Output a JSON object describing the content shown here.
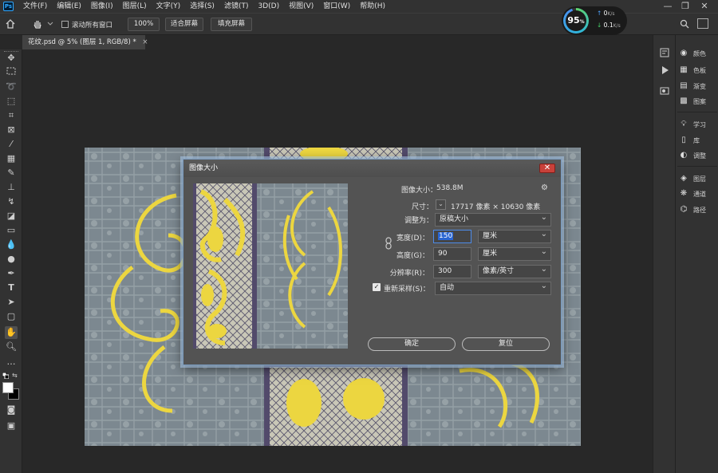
{
  "app": {
    "logo_text": "Ps"
  },
  "menu": {
    "items": [
      "文件(F)",
      "编辑(E)",
      "图像(I)",
      "图层(L)",
      "文字(Y)",
      "选择(S)",
      "滤镜(T)",
      "3D(D)",
      "视图(V)",
      "窗口(W)",
      "帮助(H)"
    ]
  },
  "window_controls": {
    "minimize": "—",
    "restore": "❐",
    "close": "✕"
  },
  "options_bar": {
    "scroll_all_label": "滚动所有窗口",
    "zoom_value": "100%",
    "fit_screen_label": "适合屏幕",
    "fill_screen_label": "填充屏幕"
  },
  "performance": {
    "percent": "95",
    "percent_unit": "%",
    "upload": "0",
    "download": "0.1",
    "unit": "K/s"
  },
  "document_tab": {
    "title": "花纹.psd @ 5% (图层 1, RGB/8) *"
  },
  "tools": [
    "move-icon",
    "marquee-icon",
    "lasso-icon",
    "object-select-icon",
    "crop-icon",
    "eyedropper-icon",
    "frame-icon",
    "healing-icon",
    "brush-icon",
    "stamp-icon",
    "history-brush-icon",
    "eraser-icon",
    "gradient-icon",
    "blur-icon",
    "dodge-icon",
    "pen-icon",
    "type-icon",
    "path-select-icon",
    "rectangle-icon",
    "hand-icon",
    "zoom-icon",
    "more-icon"
  ],
  "panels": {
    "items": [
      {
        "label": "颜色",
        "icon": "color-icon"
      },
      {
        "label": "色板",
        "icon": "swatches-icon"
      },
      {
        "label": "渐变",
        "icon": "gradient-panel-icon"
      },
      {
        "label": "图案",
        "icon": "pattern-icon"
      },
      {
        "label": "学习",
        "icon": "learn-icon"
      },
      {
        "label": "库",
        "icon": "library-icon"
      },
      {
        "label": "调整",
        "icon": "adjust-icon"
      },
      {
        "label": "图层",
        "icon": "layers-icon"
      },
      {
        "label": "通道",
        "icon": "channels-icon"
      },
      {
        "label": "路径",
        "icon": "paths-icon"
      }
    ]
  },
  "dialog": {
    "title": "图像大小",
    "image_size_label": "图像大小：",
    "image_size_value": "538.8M",
    "dimensions_label": "尺寸：",
    "dimensions_value": "17717 像素 × 10630 像素",
    "fit_to_label": "调整为：",
    "fit_to_value": "原稿大小",
    "width_label": "宽度(D)：",
    "width_value": "150",
    "width_unit": "厘米",
    "height_label": "高度(G)：",
    "height_value": "90",
    "height_unit": "厘米",
    "resolution_label": "分辨率(R)：",
    "resolution_value": "300",
    "resolution_unit": "像素/英寸",
    "resample_label": "重新采样(S)：",
    "resample_value": "自动",
    "ok_label": "确定",
    "reset_label": "复位",
    "close_glyph": "✕"
  },
  "colors": {
    "accent": "#31a8ff",
    "pattern_yellow": "#f0da3a",
    "background_gray": "#7f8b92",
    "dialog_bg": "#535353"
  }
}
